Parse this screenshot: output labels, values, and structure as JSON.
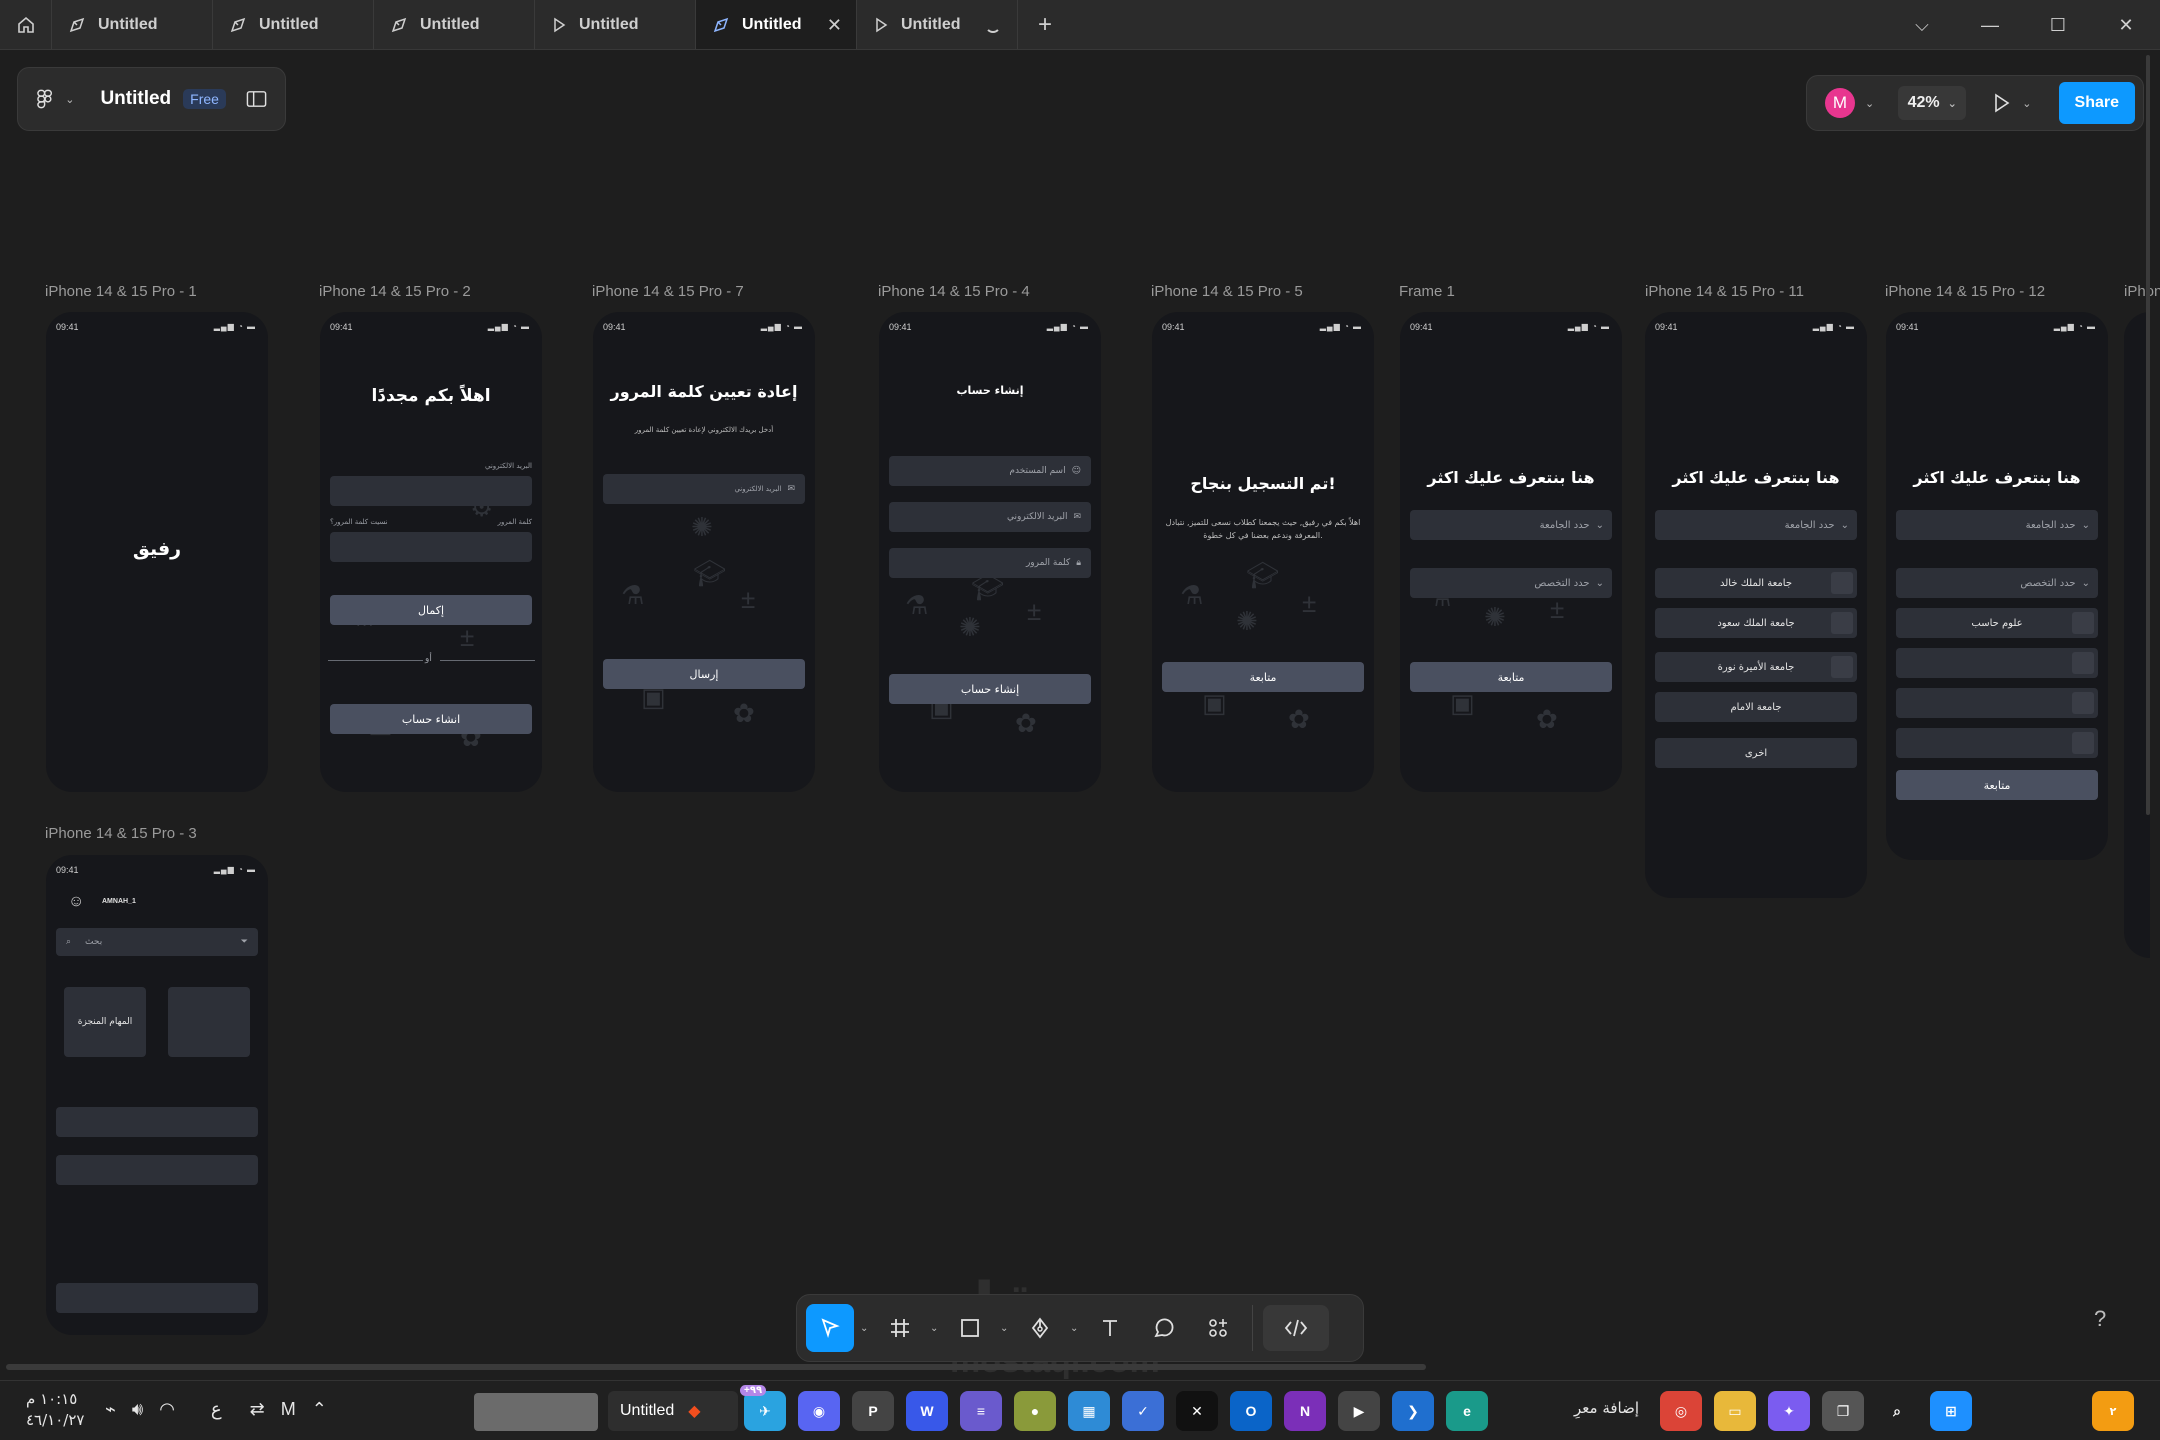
{
  "tabs": [
    {
      "label": "Untitled",
      "kind": "design",
      "active": false
    },
    {
      "label": "Untitled",
      "kind": "design",
      "active": false
    },
    {
      "label": "Untitled",
      "kind": "design",
      "active": false
    },
    {
      "label": "Untitled",
      "kind": "prototype",
      "active": false
    },
    {
      "label": "Untitled",
      "kind": "design",
      "active": true
    },
    {
      "label": "Untitled",
      "kind": "prototype",
      "active": false,
      "loading": true
    }
  ],
  "file": {
    "title": "Untitled",
    "plan": "Free"
  },
  "toolbar_right": {
    "avatar_initial": "M",
    "avatar_color": "#e8368f",
    "zoom": "42%",
    "share_label": "Share",
    "accent": "#0d99ff"
  },
  "frames": {
    "f1": {
      "label": "iPhone 14 & 15 Pro - 1",
      "time": "09:41",
      "logo": "رفيق"
    },
    "f2": {
      "label": "iPhone 14 & 15 Pro - 2",
      "time": "09:41",
      "title": "اهلاً بكم مجددًا",
      "email_label": "البريد الالكتروني",
      "password_label": "كلمة المرور",
      "forgot_label": "نسيت كلمة المرور؟",
      "continue_btn": "إكمال",
      "or_text": "أو",
      "create_btn": "انشاء حساب"
    },
    "f7": {
      "label": "iPhone 14 & 15 Pro - 7",
      "time": "09:41",
      "title": "إعادة تعيين كلمة المرور",
      "subtitle": "أدخل بريدك الالكتروني لإعادة تعيين كلمة المرور",
      "email_placeholder": "البريد الالكتروني",
      "send_btn": "إرسال"
    },
    "f4": {
      "label": "iPhone 14 & 15 Pro - 4",
      "time": "09:41",
      "title": "إنشاء حساب",
      "username_placeholder": "اسم المستخدم",
      "email_placeholder": "البريد الالكتروني",
      "password_placeholder": "كلمة المرور",
      "create_btn": "إنشاء حساب"
    },
    "f5": {
      "label": "iPhone 14 & 15 Pro - 5",
      "time": "09:41",
      "title": "تم التسجيل بنجاح!",
      "subtitle": "اهلاً بكم في رفيق, حيث يجمعنا كطلاب نسعى للتميز, نتبادل المعرفة وندعم بعضنا في كل خطوة.",
      "continue_btn": "متابعة"
    },
    "frame1": {
      "label": "Frame 1",
      "time": "09:41",
      "title": "هنا بنتعرف عليك اكثر",
      "university_dd": "حدد الجامعة",
      "major_dd": "حدد التخصص",
      "continue_btn": "متابعة"
    },
    "f11": {
      "label": "iPhone 14 & 15 Pro - 11",
      "time": "09:41",
      "title": "هنا بنتعرف عليك اكثر",
      "university_dd": "حدد الجامعة",
      "options": [
        "جامعة الملك خالد",
        "جامعة الملك سعود",
        "جامعة الأميرة نورة",
        "جامعة الامام",
        "اخرى"
      ]
    },
    "f12": {
      "label": "iPhone 14 & 15 Pro - 12",
      "time": "09:41",
      "title": "هنا بنتعرف عليك اكثر",
      "university_dd": "حدد الجامعة",
      "major_dd": "حدد التخصص",
      "major_options": [
        "علوم حاسب",
        "",
        "",
        ""
      ],
      "continue_btn": "متابعة"
    },
    "f3": {
      "label": "iPhone 14 & 15 Pro - 3",
      "time": "09:41",
      "username": "AMNAH_1",
      "search_placeholder": "بحث",
      "card1": "المهام المنجزة",
      "card2": ""
    },
    "f13": {
      "label": "iPhon"
    }
  },
  "watermark": {
    "main": "مستقل",
    "sub": "mostaql.com"
  },
  "help": "?",
  "taskbar": {
    "time": "١٠:١٥ م",
    "date": "٤٦/١٠/٢٧",
    "lang": "ع",
    "active_window": "Untitled",
    "notification_badge": "+٩٩",
    "addr_text": "إضافة معرِ",
    "alert_badge": "٢"
  }
}
